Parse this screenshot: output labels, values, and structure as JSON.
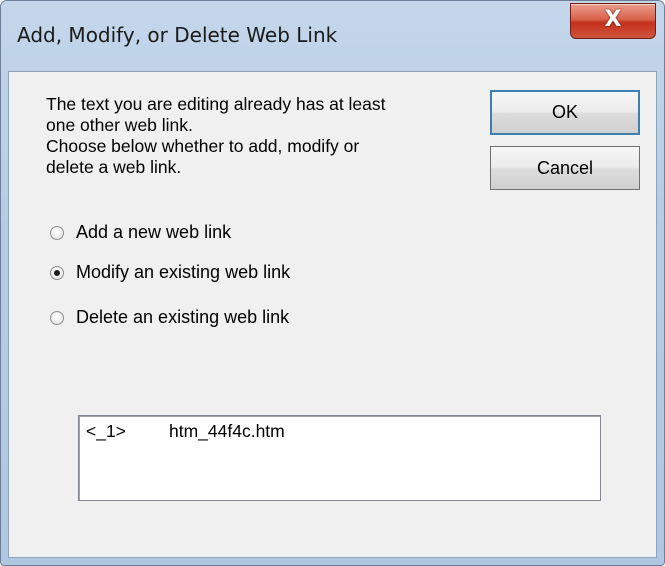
{
  "window": {
    "title": "Add, Modify, or Delete Web Link",
    "close_glyph": "X"
  },
  "message": {
    "lines": [
      "The text you are editing already has at least",
      "one other web link.",
      "Choose below whether to add, modify or",
      "delete a web link."
    ]
  },
  "buttons": {
    "ok_label": "OK",
    "cancel_label": "Cancel"
  },
  "options": [
    {
      "label": "Add a new web link",
      "selected": false
    },
    {
      "label": "Modify an existing web link",
      "selected": true
    },
    {
      "label": "Delete an existing web link",
      "selected": false
    }
  ],
  "links": [
    {
      "tag": "<_1>",
      "file": "htm_44f4c.htm"
    }
  ]
}
